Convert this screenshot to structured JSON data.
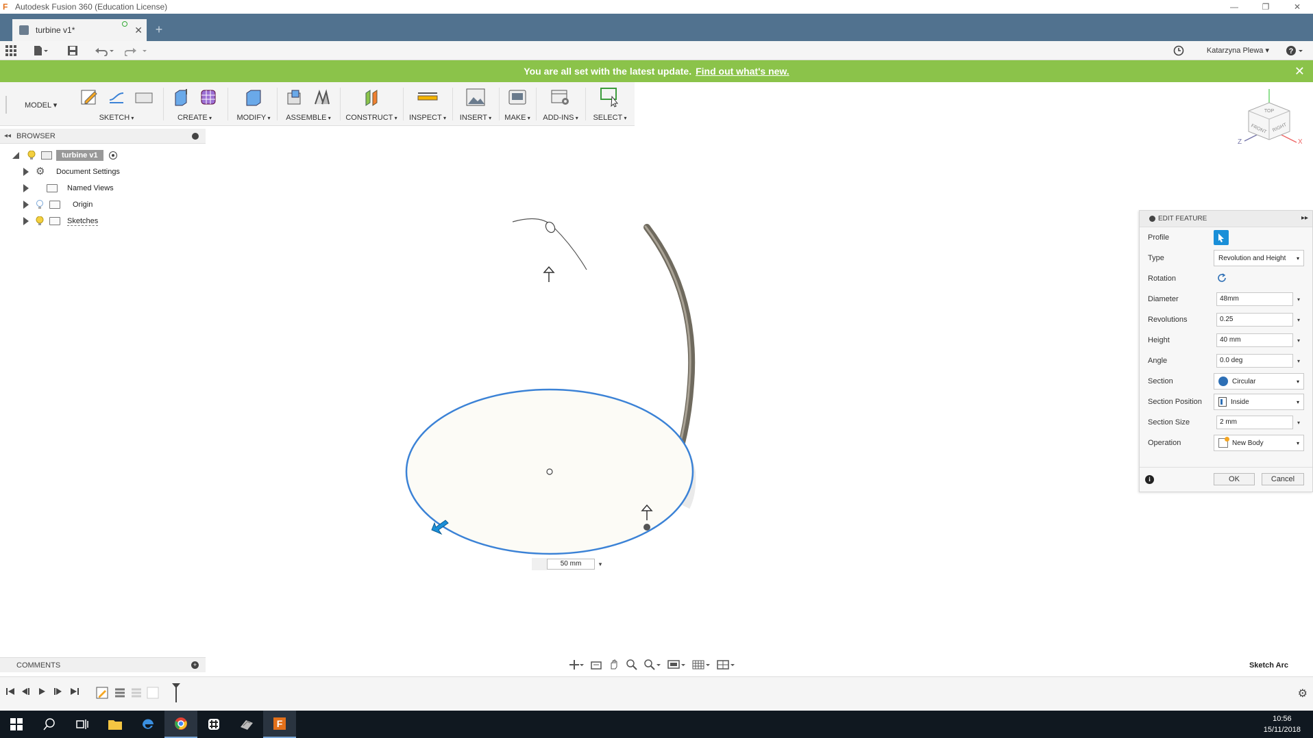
{
  "window": {
    "title": "Autodesk Fusion 360 (Education License)",
    "minimize": "—",
    "restore": "❐",
    "close": "✕"
  },
  "tabs": [
    {
      "label": "turbine v1*",
      "close": "✕"
    }
  ],
  "new_tab": "+",
  "user": {
    "name": "Katarzyna Plewa ▾"
  },
  "banner": {
    "message": "You are all set with the latest update.",
    "link": "Find out what's new.",
    "close": "✕"
  },
  "ribbon": {
    "workspace": "MODEL ▾",
    "groups": [
      "SKETCH",
      "CREATE",
      "MODIFY",
      "ASSEMBLE",
      "CONSTRUCT",
      "INSPECT",
      "INSERT",
      "MAKE",
      "ADD-INS",
      "SELECT"
    ]
  },
  "browser": {
    "title": "BROWSER",
    "items": [
      {
        "label": "turbine v1"
      },
      {
        "label": "Document Settings"
      },
      {
        "label": "Named Views"
      },
      {
        "label": "Origin"
      },
      {
        "label": "Sketches"
      }
    ]
  },
  "viewport": {
    "dimension_value": "50 mm",
    "dimension_dropdown": "▾"
  },
  "viewcube": {
    "top": "TOP",
    "front": "FRONT",
    "right": "RIGHT",
    "axis_x": "X",
    "axis_z": "Z"
  },
  "edit_feature": {
    "title": "EDIT FEATURE",
    "expand": "▸▸",
    "rows": {
      "profile": {
        "label": "Profile"
      },
      "type": {
        "label": "Type",
        "value": "Revolution and Height"
      },
      "rotation": {
        "label": "Rotation"
      },
      "diameter": {
        "label": "Diameter",
        "value": "48mm"
      },
      "revolutions": {
        "label": "Revolutions",
        "value": "0.25"
      },
      "height": {
        "label": "Height",
        "value": "40 mm"
      },
      "angle": {
        "label": "Angle",
        "value": "0.0 deg"
      },
      "section": {
        "label": "Section",
        "value": "Circular"
      },
      "section_position": {
        "label": "Section Position",
        "value": "Inside"
      },
      "section_size": {
        "label": "Section Size",
        "value": "2 mm"
      },
      "operation": {
        "label": "Operation",
        "value": "New Body"
      }
    },
    "dropdown_arrow": "▾",
    "ok": "OK",
    "cancel": "Cancel",
    "info": "i"
  },
  "comments": {
    "title": "COMMENTS",
    "add": "+"
  },
  "status": {
    "text": "Sketch Arc"
  },
  "taskbar": {
    "time": "10:56",
    "date": "15/11/2018"
  },
  "colors": {
    "tabbar": "#51728f",
    "banner": "#8bc34a",
    "sketch_blue": "#3b82d6",
    "accent": "#1a8fd8"
  }
}
